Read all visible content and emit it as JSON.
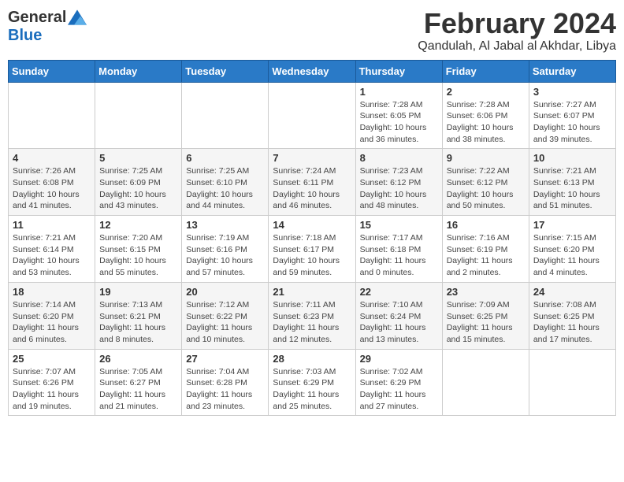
{
  "header": {
    "logo_general": "General",
    "logo_blue": "Blue",
    "month_title": "February 2024",
    "location": "Qandulah, Al Jabal al Akhdar, Libya"
  },
  "columns": [
    "Sunday",
    "Monday",
    "Tuesday",
    "Wednesday",
    "Thursday",
    "Friday",
    "Saturday"
  ],
  "weeks": [
    [
      {
        "day": "",
        "info": ""
      },
      {
        "day": "",
        "info": ""
      },
      {
        "day": "",
        "info": ""
      },
      {
        "day": "",
        "info": ""
      },
      {
        "day": "1",
        "info": "Sunrise: 7:28 AM\nSunset: 6:05 PM\nDaylight: 10 hours and 36 minutes."
      },
      {
        "day": "2",
        "info": "Sunrise: 7:28 AM\nSunset: 6:06 PM\nDaylight: 10 hours and 38 minutes."
      },
      {
        "day": "3",
        "info": "Sunrise: 7:27 AM\nSunset: 6:07 PM\nDaylight: 10 hours and 39 minutes."
      }
    ],
    [
      {
        "day": "4",
        "info": "Sunrise: 7:26 AM\nSunset: 6:08 PM\nDaylight: 10 hours and 41 minutes."
      },
      {
        "day": "5",
        "info": "Sunrise: 7:25 AM\nSunset: 6:09 PM\nDaylight: 10 hours and 43 minutes."
      },
      {
        "day": "6",
        "info": "Sunrise: 7:25 AM\nSunset: 6:10 PM\nDaylight: 10 hours and 44 minutes."
      },
      {
        "day": "7",
        "info": "Sunrise: 7:24 AM\nSunset: 6:11 PM\nDaylight: 10 hours and 46 minutes."
      },
      {
        "day": "8",
        "info": "Sunrise: 7:23 AM\nSunset: 6:12 PM\nDaylight: 10 hours and 48 minutes."
      },
      {
        "day": "9",
        "info": "Sunrise: 7:22 AM\nSunset: 6:12 PM\nDaylight: 10 hours and 50 minutes."
      },
      {
        "day": "10",
        "info": "Sunrise: 7:21 AM\nSunset: 6:13 PM\nDaylight: 10 hours and 51 minutes."
      }
    ],
    [
      {
        "day": "11",
        "info": "Sunrise: 7:21 AM\nSunset: 6:14 PM\nDaylight: 10 hours and 53 minutes."
      },
      {
        "day": "12",
        "info": "Sunrise: 7:20 AM\nSunset: 6:15 PM\nDaylight: 10 hours and 55 minutes."
      },
      {
        "day": "13",
        "info": "Sunrise: 7:19 AM\nSunset: 6:16 PM\nDaylight: 10 hours and 57 minutes."
      },
      {
        "day": "14",
        "info": "Sunrise: 7:18 AM\nSunset: 6:17 PM\nDaylight: 10 hours and 59 minutes."
      },
      {
        "day": "15",
        "info": "Sunrise: 7:17 AM\nSunset: 6:18 PM\nDaylight: 11 hours and 0 minutes."
      },
      {
        "day": "16",
        "info": "Sunrise: 7:16 AM\nSunset: 6:19 PM\nDaylight: 11 hours and 2 minutes."
      },
      {
        "day": "17",
        "info": "Sunrise: 7:15 AM\nSunset: 6:20 PM\nDaylight: 11 hours and 4 minutes."
      }
    ],
    [
      {
        "day": "18",
        "info": "Sunrise: 7:14 AM\nSunset: 6:20 PM\nDaylight: 11 hours and 6 minutes."
      },
      {
        "day": "19",
        "info": "Sunrise: 7:13 AM\nSunset: 6:21 PM\nDaylight: 11 hours and 8 minutes."
      },
      {
        "day": "20",
        "info": "Sunrise: 7:12 AM\nSunset: 6:22 PM\nDaylight: 11 hours and 10 minutes."
      },
      {
        "day": "21",
        "info": "Sunrise: 7:11 AM\nSunset: 6:23 PM\nDaylight: 11 hours and 12 minutes."
      },
      {
        "day": "22",
        "info": "Sunrise: 7:10 AM\nSunset: 6:24 PM\nDaylight: 11 hours and 13 minutes."
      },
      {
        "day": "23",
        "info": "Sunrise: 7:09 AM\nSunset: 6:25 PM\nDaylight: 11 hours and 15 minutes."
      },
      {
        "day": "24",
        "info": "Sunrise: 7:08 AM\nSunset: 6:25 PM\nDaylight: 11 hours and 17 minutes."
      }
    ],
    [
      {
        "day": "25",
        "info": "Sunrise: 7:07 AM\nSunset: 6:26 PM\nDaylight: 11 hours and 19 minutes."
      },
      {
        "day": "26",
        "info": "Sunrise: 7:05 AM\nSunset: 6:27 PM\nDaylight: 11 hours and 21 minutes."
      },
      {
        "day": "27",
        "info": "Sunrise: 7:04 AM\nSunset: 6:28 PM\nDaylight: 11 hours and 23 minutes."
      },
      {
        "day": "28",
        "info": "Sunrise: 7:03 AM\nSunset: 6:29 PM\nDaylight: 11 hours and 25 minutes."
      },
      {
        "day": "29",
        "info": "Sunrise: 7:02 AM\nSunset: 6:29 PM\nDaylight: 11 hours and 27 minutes."
      },
      {
        "day": "",
        "info": ""
      },
      {
        "day": "",
        "info": ""
      }
    ]
  ]
}
